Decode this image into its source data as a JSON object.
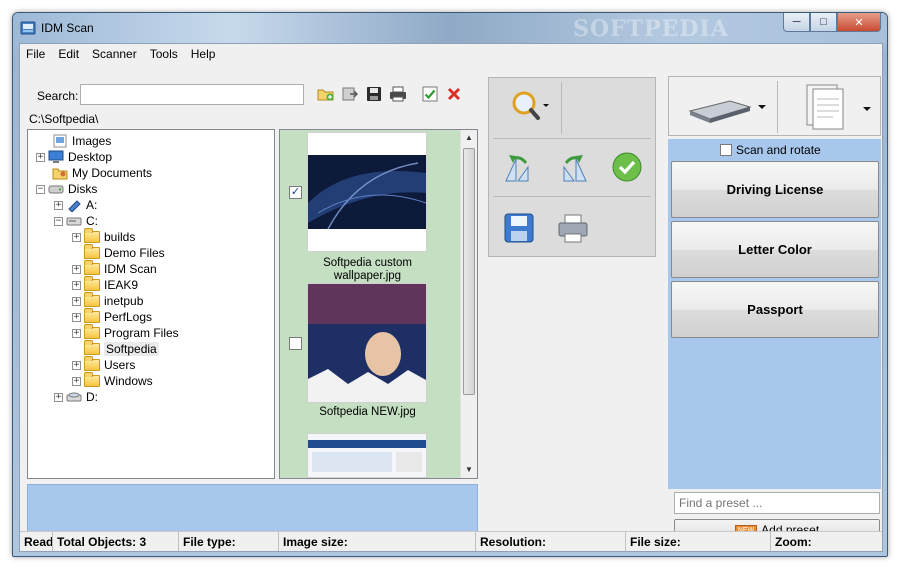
{
  "window": {
    "title": "IDM Scan",
    "watermark": "SOFTPEDIA",
    "controls": {
      "minimize": "─",
      "maximize": "□",
      "close": "✕"
    }
  },
  "menu": [
    "File",
    "Edit",
    "Scanner",
    "Tools",
    "Help"
  ],
  "search": {
    "label": "Search:",
    "value": ""
  },
  "path": "C:\\Softpedia\\",
  "tree": {
    "images": "Images",
    "desktop": "Desktop",
    "my_documents": "My Documents",
    "disks": "Disks",
    "drive_a": "A:",
    "drive_c": "C:",
    "folders": [
      "builds",
      "Demo Files",
      "IDM Scan",
      "IEAK9",
      "inetpub",
      "PerfLogs",
      "Program Files",
      "Softpedia",
      "Users",
      "Windows"
    ],
    "selected_folder": "Softpedia",
    "drive_d": "D:"
  },
  "thumbnails": [
    {
      "caption": "Softpedia custom wallpaper.jpg",
      "checked": true,
      "check_mark": "✓"
    },
    {
      "caption": "Softpedia NEW.jpg",
      "checked": false,
      "check_mark": ""
    },
    {
      "caption": "",
      "checked": false,
      "check_mark": ""
    }
  ],
  "presets": {
    "scan_and_rotate": "Scan and rotate",
    "buttons": [
      "Driving License",
      "Letter Color",
      "Passport"
    ],
    "find_placeholder": "Find a preset ...",
    "new_badge": "NEW",
    "add_label": "Add preset"
  },
  "status": {
    "ready": "Ready",
    "total_objects": "Total Objects: 3",
    "file_type": "File type:",
    "image_size": "Image size:",
    "resolution": "Resolution:",
    "file_size": "File size:",
    "zoom": "Zoom:"
  },
  "icons": {
    "toolbar": [
      "new-folder-icon",
      "export-icon",
      "save-icon",
      "print-icon",
      "check-icon",
      "delete-icon"
    ],
    "middle": [
      "zoom-icon",
      "rotate-left-icon",
      "rotate-right-icon",
      "accept-icon",
      "save-icon",
      "scanner-icon"
    ],
    "scan": [
      "scanner-icon",
      "document-pages-icon"
    ]
  },
  "colors": {
    "accent_blue": "#a7c7ed",
    "thumb_bg": "#c5dfc3",
    "delete_red": "#d9302a",
    "check_green": "#2e9b2e"
  }
}
